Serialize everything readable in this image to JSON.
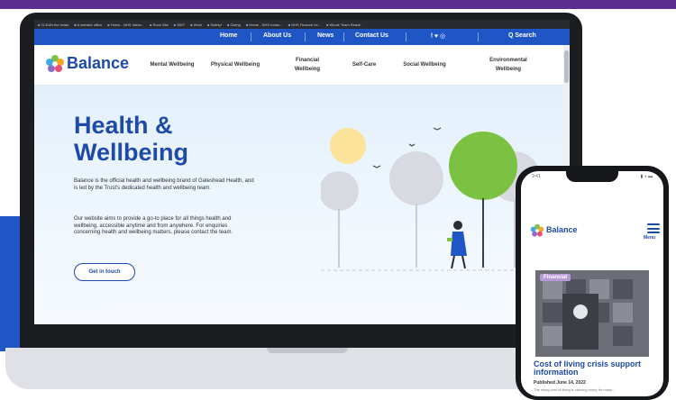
{
  "browser": {
    "bookmarks": [
      "CLEAN the hosts",
      "A website office",
      "Home - NHS Intran...",
      "Rock Site",
      "SWT",
      "Work",
      "Safety!",
      "Giving",
      "Home - NHS Intran...",
      "NHS Finance Int...",
      "Whole Team Reach"
    ]
  },
  "topnav": {
    "items": [
      "Home",
      "About Us",
      "News",
      "Contact Us"
    ],
    "social": "f ♥ ◎",
    "search_label": "Q Search"
  },
  "site": {
    "logo_text": "Balance",
    "menu": [
      {
        "label": "Mental Wellbeing"
      },
      {
        "label": "Physical Wellbeing"
      },
      {
        "label": "Financial Wellbeing"
      },
      {
        "label": "Self-Care"
      },
      {
        "label": "Social Wellbeing"
      },
      {
        "label": "Environmental Wellbeing"
      }
    ]
  },
  "hero": {
    "title_line1": "Health &",
    "title_line2": "Wellbeing",
    "para1": "Balance is the official health and wellbeing brand of Gateshead Health, and is led by the Trust's dedicated health and wellbeing team.",
    "para2": "Our website aims to provide a go-to place for all things health and wellbeing, accessible anytime and from anywhere. For enquiries concerning health and wellbeing matters, please contact the team.",
    "cta_label": "Get in touch"
  },
  "phone": {
    "status_time": "9:41",
    "status_icons": "▮ ◖ ▬",
    "logo_text": "Balance",
    "menu_label": "Menu",
    "article": {
      "badge": "Financial",
      "title": "Cost of living crisis support information",
      "date": "Published June 14, 2022",
      "snippet": "The rising cost of living is causing worry for many..."
    }
  },
  "colors": {
    "brand_blue": "#1e4aa8",
    "nav_blue": "#1f55c4",
    "purple_band": "#5b2d8e",
    "tree_green": "#7cc242",
    "sun_yellow": "#fbe39a"
  }
}
